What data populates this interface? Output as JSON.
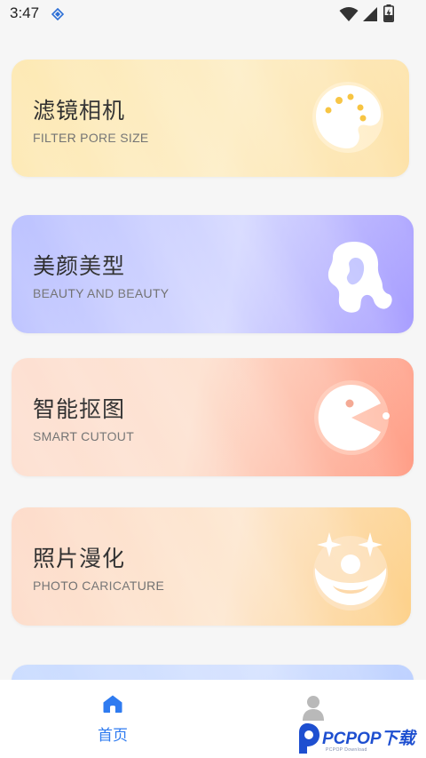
{
  "status_bar": {
    "time": "3:47"
  },
  "cards": [
    {
      "title": "滤镜相机",
      "subtitle": "FILTER PORE SIZE",
      "icon": "palette-icon"
    },
    {
      "title": "美颜美型",
      "subtitle": "BEAUTY AND BEAUTY",
      "icon": "woman-head-icon"
    },
    {
      "title": "智能抠图",
      "subtitle": "SMART CUTOUT",
      "icon": "pacman-icon"
    },
    {
      "title": "照片漫化",
      "subtitle": "PHOTO CARICATURE",
      "icon": "clown-face-icon"
    }
  ],
  "tab_bar": {
    "home_label": "首页"
  },
  "watermark": {
    "brand": "PCPOP下载",
    "tagline": "PCPOP Download"
  },
  "colors": {
    "accent": "#2f7bf0"
  }
}
